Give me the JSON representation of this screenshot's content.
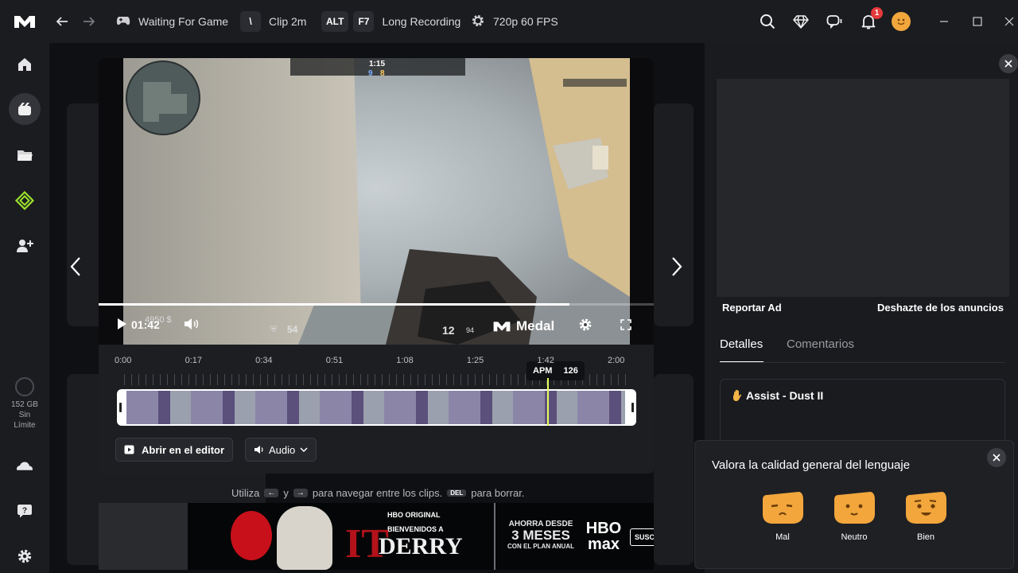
{
  "topbar": {
    "status_label": "Waiting For Game",
    "clip_key": "\\",
    "clip_label": "Clip 2m",
    "recording_key_1": "ALT",
    "recording_key_2": "F7",
    "recording_label": "Long Recording",
    "quality_label": "720p 60 FPS",
    "notification_count": "1"
  },
  "sidebar": {
    "storage_size": "152 GB",
    "storage_limit_line1": "Sin",
    "storage_limit_line2": "Límite"
  },
  "player": {
    "time_current": "01:42",
    "brand": "Medal",
    "game_hud": {
      "round_time": "1:15",
      "score_left": "9",
      "score_right": "8",
      "health": "54",
      "money": "4950 $",
      "ammo": "12",
      "ammo_reserve": "94"
    }
  },
  "timeline": {
    "ticks": [
      "0:00",
      "0:17",
      "0:34",
      "0:51",
      "1:08",
      "1:25",
      "1:42",
      "2:00"
    ],
    "tooltip_label": "APM",
    "tooltip_value": "126"
  },
  "actions": {
    "open_editor": "Abrir en el editor",
    "audio": "Audio"
  },
  "hint": {
    "prefix": "Utiliza",
    "key_left": "←",
    "conj": "y",
    "key_right": "→",
    "middle": "para navegar entre los clips.",
    "key_del": "DEL",
    "suffix": "para borrar."
  },
  "ad_banner": {
    "line1": "HBO ORIGINAL",
    "line2": "BIENVENIDOS A",
    "title": "DERRY",
    "offer1": "AHORRA DESDE",
    "offer2": "3 MESES",
    "offer3": "CON EL PLAN ANUAL",
    "brand1": "HBO",
    "brand2": "max",
    "cta": "SUSC"
  },
  "right_panel": {
    "report_ad": "Reportar Ad",
    "remove_ads": "Deshazte de los anuncios",
    "tab_details": "Detalles",
    "tab_comments": "Comentarios",
    "clip_title": "Assist - Dust II"
  },
  "rating": {
    "question": "Valora la calidad general del lenguaje",
    "options": [
      "Mal",
      "Neutro",
      "Bien"
    ]
  },
  "colors": {
    "accent_green": "#9be22d",
    "face_orange": "#f2a63c",
    "tooltip_bg": "#101114"
  }
}
